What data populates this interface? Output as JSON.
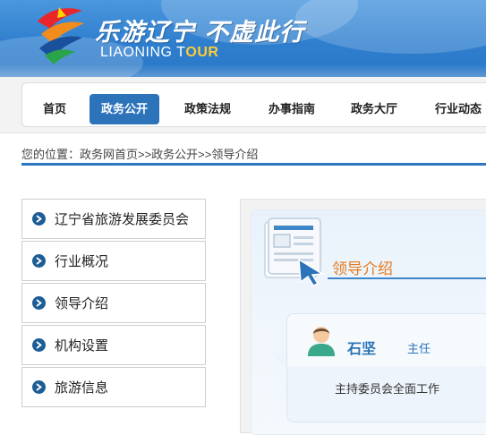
{
  "header": {
    "slogan": "乐游辽宁 不虚此行",
    "brand_prefix": "LIAONING T",
    "brand_suffix": "OUR",
    "accent_color": "#ffcc33"
  },
  "nav": {
    "items": [
      {
        "label": "首页",
        "active": false
      },
      {
        "label": "政务公开",
        "active": true
      },
      {
        "label": "政策法规",
        "active": false
      },
      {
        "label": "办事指南",
        "active": false
      },
      {
        "label": "政务大厅",
        "active": false
      },
      {
        "label": "行业动态",
        "active": false
      }
    ],
    "active_color": "#2c73b9"
  },
  "breadcrumb": {
    "text": "您的位置：政务网首页>>政务公开>>领导介绍"
  },
  "sidebar": {
    "items": [
      {
        "label": "辽宁省旅游发展委员会",
        "icon": "chevron-right-circle-icon"
      },
      {
        "label": "行业概况",
        "icon": "chevron-right-circle-icon"
      },
      {
        "label": "领导介绍",
        "icon": "chevron-right-circle-icon"
      },
      {
        "label": "机构设置",
        "icon": "chevron-right-circle-icon"
      },
      {
        "label": "旅游信息",
        "icon": "chevron-right-circle-icon"
      }
    ]
  },
  "main": {
    "section_title": "领导介绍",
    "section_icon": "document-cursor-icon",
    "leader": {
      "name": "石坚",
      "title": "主任",
      "duty": "主持委员会全面工作",
      "avatar_icon": "person-avatar-icon"
    },
    "title_color": "#e87a1e",
    "name_color": "#2b74b8"
  }
}
